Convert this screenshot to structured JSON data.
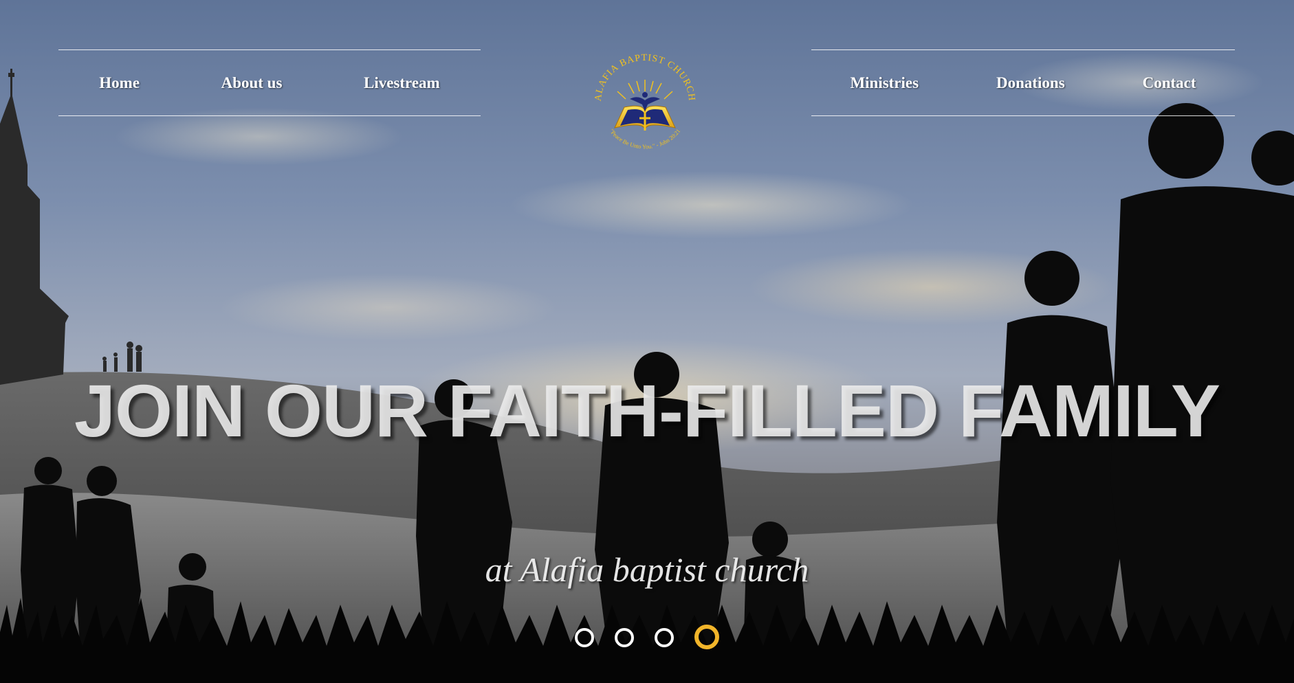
{
  "nav": {
    "left": [
      {
        "label": "Home"
      },
      {
        "label": "About us"
      },
      {
        "label": "Livestream"
      }
    ],
    "right": [
      {
        "label": "Ministries"
      },
      {
        "label": "Donations"
      },
      {
        "label": "Contact"
      }
    ]
  },
  "logo": {
    "top_text": "ALAFIA BAPTIST CHURCH",
    "bottom_text": "\"Peace Be Unto You.\" - John 20:21",
    "icon": "dove-book-cross-emblem"
  },
  "hero": {
    "headline": "JOIN OUR FAITH-FILLED FAMILY",
    "subline": "at Alafia baptist church"
  },
  "carousel": {
    "slide_count": 4,
    "active_index": 3,
    "active_color": "#f2b52a",
    "inactive_color": "#ffffff"
  }
}
